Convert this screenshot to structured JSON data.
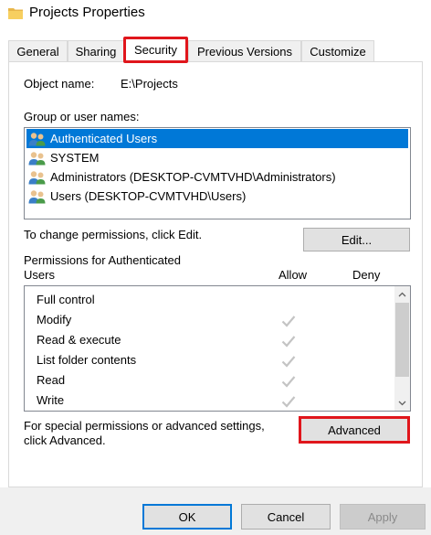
{
  "window": {
    "title": "Projects Properties",
    "icon": "folder-icon"
  },
  "tabs": [
    {
      "label": "General",
      "active": false
    },
    {
      "label": "Sharing",
      "active": false
    },
    {
      "label": "Security",
      "active": true
    },
    {
      "label": "Previous Versions",
      "active": false
    },
    {
      "label": "Customize",
      "active": false
    }
  ],
  "security": {
    "object_name_label": "Object name:",
    "object_name_value": "E:\\Projects",
    "group_label": "Group or user names:",
    "users": [
      {
        "name": "Authenticated Users",
        "selected": true,
        "icon": "users-icon"
      },
      {
        "name": "SYSTEM",
        "selected": false,
        "icon": "users-icon"
      },
      {
        "name": "Administrators (DESKTOP-CVMTVHD\\Administrators)",
        "selected": false,
        "icon": "users-icon"
      },
      {
        "name": "Users (DESKTOP-CVMTVHD\\Users)",
        "selected": false,
        "icon": "users-icon"
      }
    ],
    "change_text": "To change permissions, click Edit.",
    "edit_label": "Edit...",
    "perm_header_line1": "Permissions for Authenticated",
    "perm_header_line2": "Users",
    "allow_label": "Allow",
    "deny_label": "Deny",
    "permissions": [
      {
        "name": "Full control",
        "allow": false,
        "deny": false
      },
      {
        "name": "Modify",
        "allow": true,
        "deny": false
      },
      {
        "name": "Read & execute",
        "allow": true,
        "deny": false
      },
      {
        "name": "List folder contents",
        "allow": true,
        "deny": false
      },
      {
        "name": "Read",
        "allow": true,
        "deny": false
      },
      {
        "name": "Write",
        "allow": true,
        "deny": false
      }
    ],
    "advanced_text_line1": "For special permissions or advanced settings,",
    "advanced_text_line2": "click Advanced.",
    "advanced_label": "Advanced"
  },
  "footer": {
    "ok_label": "OK",
    "cancel_label": "Cancel",
    "apply_label": "Apply"
  },
  "colors": {
    "selection": "#0078d7",
    "highlight": "#e0161c",
    "check": "#c4c4c4"
  }
}
